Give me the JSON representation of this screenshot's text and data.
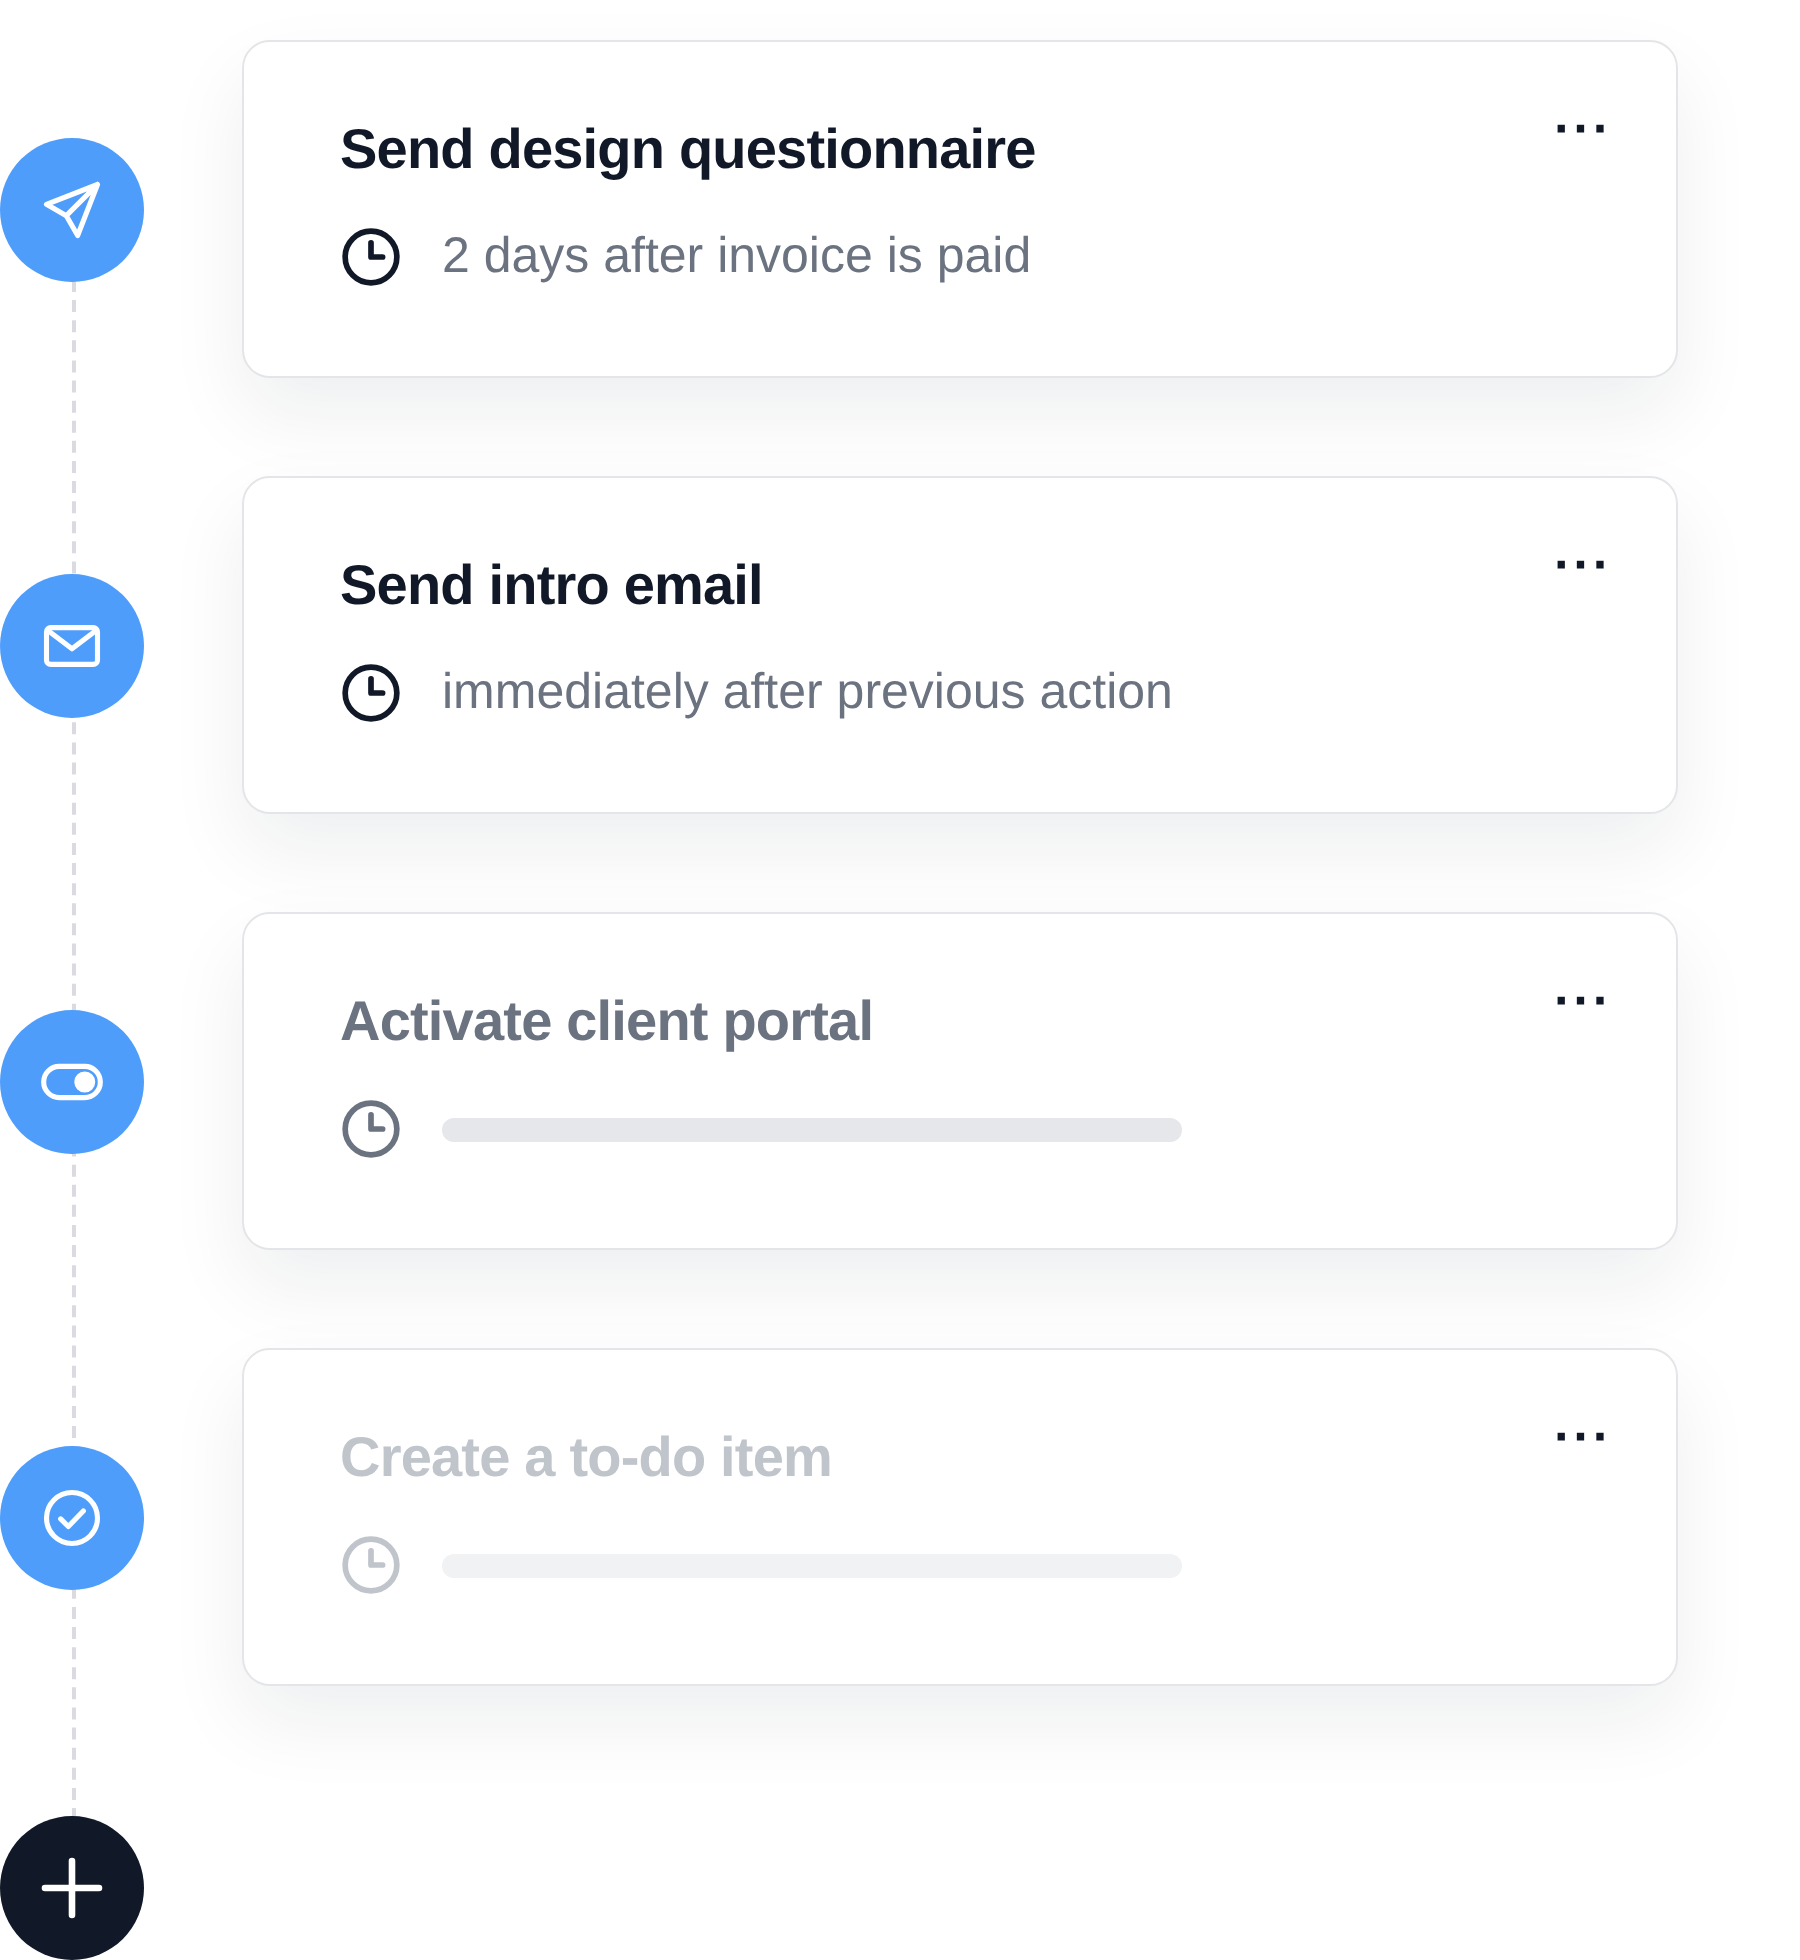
{
  "steps": [
    {
      "title": "Send design questionnaire",
      "kind": "scheduled",
      "timing": "2 days after invoice is paid",
      "menu": "···"
    },
    {
      "title": "Send intro email",
      "kind": "scheduled",
      "timing": "immediately after previous action",
      "menu": "···"
    },
    {
      "title": "Activate client portal",
      "kind": "pending",
      "menu": "···"
    },
    {
      "title": "Create a to-do item",
      "kind": "inactive",
      "menu": "···"
    }
  ]
}
